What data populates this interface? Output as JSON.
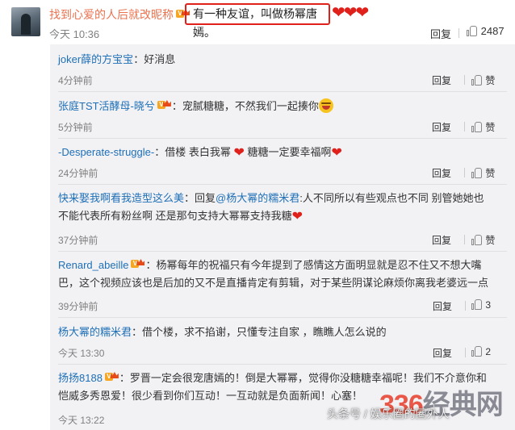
{
  "top": {
    "username": "找到心爱的人后就改昵称",
    "highlight_text": "有一种友谊，叫做杨幂唐嫣。",
    "hearts": "❤❤❤",
    "time": "今天 10:36",
    "reply": "回复",
    "likes": "2487"
  },
  "comments": [
    {
      "user": "joker薛的方宝宝",
      "vip": false,
      "text": "：好消息",
      "time": "4分钟前",
      "reply": "回复",
      "action": "赞"
    },
    {
      "user": "张庭TST活酵母-晓兮",
      "vip": true,
      "text": "：宠腻糖糖，不然我们一起揍你",
      "time": "5分钟前",
      "reply": "回复",
      "action": "赞"
    },
    {
      "user": "-Desperate-struggle-",
      "vip": false,
      "text1": "：借楼 表白我幂",
      "text2": "糖糖一定要幸福啊",
      "time": "24分钟前",
      "reply": "回复",
      "action": "赞"
    },
    {
      "user": "快来娶我啊看我造型这么美",
      "vip": false,
      "prefix": "：回复",
      "mention": "@杨大幂的糯米君",
      "line1": ":人不同所以有些观点也不同 别管她她也",
      "line2": "不能代表所有粉丝啊 还是那句支持大幂幂支持我糖",
      "time": "37分钟前",
      "reply": "回复",
      "action": "赞"
    },
    {
      "user": "Renard_abeille",
      "vip": true,
      "line1": "：杨幂每年的祝福只有今年提到了感情这方面明显就是忍不住又不想大嘴",
      "line2": "巴，这个视频应该也是后加的又不是直播肯定有剪辑，对于某些阴谋论麻烦你离我老婆远一点",
      "time": "39分钟前",
      "reply": "回复",
      "action": "3"
    },
    {
      "user": "杨大幂的糯米君",
      "vip": false,
      "text": "：借个楼，求不掐谢，只懂专注自家 ，瞧瞧人怎么说的",
      "time": "今天 13:30",
      "reply": "回复",
      "action": "2"
    },
    {
      "user": "扬扬8188",
      "vip": true,
      "line1": "：罗晋一定会很宠唐嫣的！倒是大幂幂，觉得你没糖糖幸福呢！我们不介意你和",
      "line2": "恺威多秀恩爱！很少看到你们互动！一互动就是负面新闻！心塞！",
      "time": "今天 13:22"
    }
  ],
  "watermark": {
    "logo_part1": "336",
    "logo_part2": "经典网",
    "caption": "头条号 / 娱乐圈的圈外人"
  }
}
